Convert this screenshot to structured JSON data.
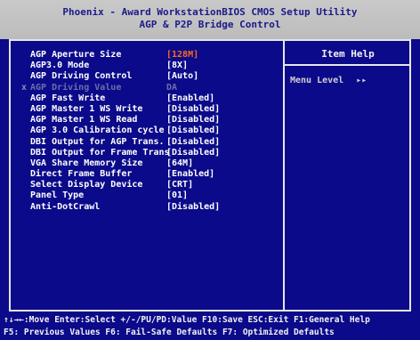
{
  "header": {
    "title": "Phoenix - Award WorkstationBIOS CMOS Setup Utility",
    "subtitle": "AGP & P2P Bridge Control"
  },
  "help": {
    "title": "Item Help",
    "menu_level_label": "Menu Level",
    "menu_level_arrows": "▸▸"
  },
  "settings": [
    {
      "label": "AGP Aperture Size",
      "value": "[128M]"
    },
    {
      "label": "AGP3.0 Mode",
      "value": "[8X]"
    },
    {
      "label": "AGP Driving Control",
      "value": "[Auto]"
    },
    {
      "label": "AGP Driving Value",
      "value": "DA"
    },
    {
      "label": "AGP Fast Write",
      "value": "[Enabled]"
    },
    {
      "label": "AGP Master 1 WS Write",
      "value": "[Disabled]"
    },
    {
      "label": "AGP Master 1 WS Read",
      "value": "[Disabled]"
    },
    {
      "label": "AGP 3.0 Calibration cycle",
      "value": "[Disabled]"
    },
    {
      "label": "DBI Output for AGP Trans.",
      "value": "[Disabled]"
    },
    {
      "label": "DBI Output for Frame Trans",
      "value": "[Disabled]"
    },
    {
      "label": "VGA Share Memory Size",
      "value": "[64M]"
    },
    {
      "label": "Direct Frame Buffer",
      "value": "[Enabled]"
    },
    {
      "label": "Select Display Device",
      "value": "[CRT]"
    },
    {
      "label": "Panel Type",
      "value": "[01]"
    },
    {
      "label": "Anti-DotCrawl",
      "value": "[Disabled]"
    }
  ],
  "selected_marker": "x",
  "footer": {
    "line1": "↑↓→←:Move  Enter:Select  +/-/PU/PD:Value  F10:Save  ESC:Exit  F1:General Help",
    "line2": "  F5: Previous Values   F6: Fail-Safe Defaults   F7: Optimized Defaults"
  },
  "colors": {
    "background": "#0b0a8a",
    "header": "#c0c0c0",
    "selected_value": "#ff6a1c",
    "disabled_text": "#6e6ea8"
  }
}
